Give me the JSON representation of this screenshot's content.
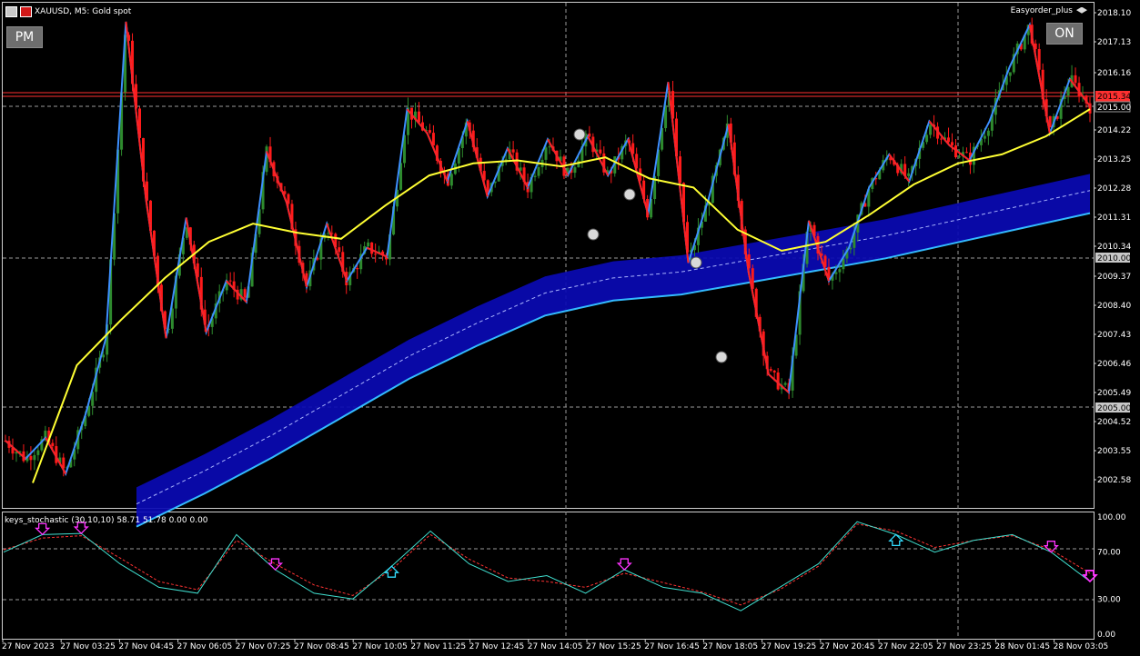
{
  "window": {
    "symbol_title": "XAUUSD, M5:  Gold spot",
    "ea_name": "Easyorder_plus"
  },
  "buttons": {
    "pm_label": "PM",
    "on_label": "ON"
  },
  "colors": {
    "background": "#000000",
    "bull_candle": "#2e8b2e",
    "bear_candle": "#ff1a1a",
    "zigzag_up": "#3d8fff",
    "zigzag_down": "#ff2020",
    "ma_yellow": "#ffff33",
    "band_fill": "#0a0ab4",
    "band_edge": "#33bbff",
    "stoch_main": "#40e0d0",
    "stoch_signal": "#ff3333"
  },
  "price_axis": {
    "labels": [
      "2018.10",
      "2017.13",
      "2016.16",
      "2015.34",
      "2015.00",
      "2014.22",
      "2013.25",
      "2012.28",
      "2011.31",
      "2010.34",
      "2010.00",
      "2009.37",
      "2008.40",
      "2007.43",
      "2006.46",
      "2005.49",
      "2005.00",
      "2004.52",
      "2003.55",
      "2002.58"
    ]
  },
  "time_axis": {
    "labels": [
      "27 Nov 2023",
      "27 Nov 03:25",
      "27 Nov 04:45",
      "27 Nov 06:05",
      "27 Nov 07:25",
      "27 Nov 08:45",
      "27 Nov 10:05",
      "27 Nov 11:25",
      "27 Nov 12:45",
      "27 Nov 14:05",
      "27 Nov 15:25",
      "27 Nov 16:45",
      "27 Nov 18:05",
      "27 Nov 19:25",
      "27 Nov 20:45",
      "27 Nov 22:05",
      "27 Nov 23:25",
      "28 Nov 01:45",
      "28 Nov 03:05"
    ]
  },
  "price_lines": {
    "bid_label": "2015.34",
    "level_1_label": "2015.00",
    "level_2_label": "2010.00",
    "level_3_label": "2005.00"
  },
  "indicator": {
    "title": "keys_stochastic (30,10,10) 58.71 51.78 0.00 0.00",
    "axis_labels": [
      "100.00",
      "70.00",
      "30.00",
      "0.00"
    ]
  },
  "chart_data": {
    "type": "line",
    "main_series": [
      {
        "name": "price_path",
        "values": [
          2004.0,
          2003.4,
          2004.1,
          2002.9,
          2004.9,
          2007.4,
          2017.9,
          2012.0,
          2007.4,
          2011.4,
          2007.6,
          2009.3,
          2008.6,
          2013.6,
          2011.9,
          2009.1,
          2011.2,
          2009.3,
          2010.4,
          2010.1,
          2015.0,
          2014.2,
          2012.6,
          2014.6,
          2012.1,
          2013.7,
          2012.4,
          2014.0,
          2012.8,
          2014.1,
          2012.8,
          2014.0,
          2011.5,
          2015.9,
          2009.9,
          2012.0,
          2014.5,
          2009.6,
          2006.2,
          2005.6,
          2011.3,
          2009.3,
          2010.4,
          2012.4,
          2013.5,
          2012.6,
          2014.6,
          2013.8,
          2013.3,
          2014.6,
          2016.4,
          2017.8,
          2014.2,
          2016.0,
          2015.1
        ]
      }
    ],
    "ma_yellow": [
      2002.6,
      2006.5,
      2008.0,
      2009.4,
      2010.6,
      2011.2,
      2010.9,
      2010.7,
      2011.8,
      2012.8,
      2013.2,
      2013.3,
      2013.1,
      2013.4,
      2012.7,
      2012.4,
      2011.0,
      2010.3,
      2010.6,
      2011.5,
      2012.5,
      2013.2,
      2013.5,
      2014.1,
      2015.0
    ],
    "band_mid": [
      2001.9,
      2003.0,
      2004.2,
      2005.5,
      2006.8,
      2007.9,
      2008.9,
      2009.4,
      2009.6,
      2010.0,
      2010.4,
      2010.8,
      2011.3,
      2011.8,
      2012.3
    ],
    "stoch_main": [
      70,
      85,
      86,
      60,
      40,
      35,
      85,
      55,
      35,
      30,
      58,
      88,
      60,
      45,
      50,
      35,
      55,
      40,
      35,
      20,
      40,
      60,
      96,
      85,
      70,
      80,
      85,
      70,
      45
    ],
    "stoch_signal": [
      72,
      82,
      84,
      65,
      45,
      38,
      80,
      60,
      42,
      33,
      55,
      85,
      64,
      48,
      45,
      40,
      52,
      44,
      36,
      25,
      38,
      58,
      94,
      88,
      74,
      80,
      84,
      72,
      52
    ],
    "arrows_down_at": [
      1,
      2,
      7,
      16,
      27,
      28,
      29,
      30,
      33,
      35
    ],
    "arrows_up_at": [
      10,
      23
    ],
    "ylim": [
      2001.8,
      2018.5
    ]
  }
}
